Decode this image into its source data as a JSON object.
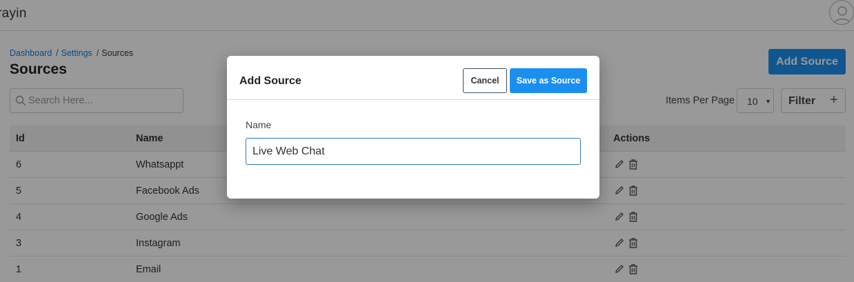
{
  "app": {
    "logo": "rayin"
  },
  "breadcrumb": {
    "items": [
      "Dashboard",
      "Settings",
      "Sources"
    ],
    "separator": "/"
  },
  "page": {
    "title": "Sources",
    "add_button": "Add Source"
  },
  "search": {
    "placeholder": "Search Here...",
    "value": ""
  },
  "pagination": {
    "items_per_page_label": "Items Per Page",
    "items_per_page_value": "10"
  },
  "filter": {
    "label": "Filter",
    "icon": "plus-icon"
  },
  "table": {
    "columns": [
      "Id",
      "Name",
      "Actions"
    ],
    "rows": [
      {
        "id": "6",
        "name": "Whatsappt"
      },
      {
        "id": "5",
        "name": "Facebook Ads"
      },
      {
        "id": "4",
        "name": "Google Ads"
      },
      {
        "id": "3",
        "name": "Instagram"
      },
      {
        "id": "1",
        "name": "Email"
      }
    ],
    "row_actions": [
      "edit-icon",
      "trash-icon"
    ]
  },
  "modal": {
    "title": "Add Source",
    "cancel_label": "Cancel",
    "save_label": "Save as Source",
    "field_label": "Name",
    "field_value": "Live Web Chat"
  },
  "colors": {
    "primary": "#1b8ff0",
    "link": "#0d7bd6",
    "input_focus": "#2a7bc0"
  }
}
